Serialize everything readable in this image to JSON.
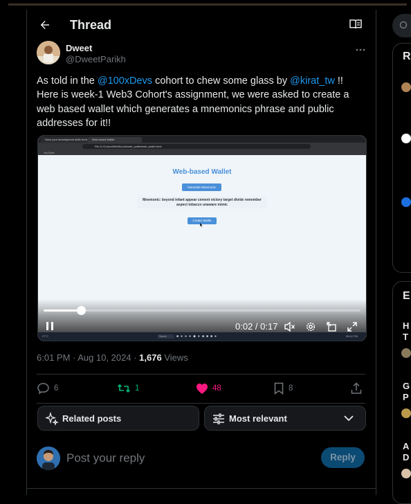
{
  "header": {
    "title": "Thread"
  },
  "author": {
    "name": "Dweet",
    "handle": "@DweetParikh"
  },
  "tweet": {
    "parts": [
      {
        "t": "As told in the ",
        "m": false
      },
      {
        "t": "@100xDevs",
        "m": true
      },
      {
        "t": " cohort to chew some glass by ",
        "m": false
      },
      {
        "t": "@kirat_tw",
        "m": true
      },
      {
        "t": " !! Here is week-1 Web3 Cohort's assignment, we were asked to create a web based wallet which generates a mnemonics phrase and public addresses for it!!",
        "m": false
      }
    ]
  },
  "video": {
    "browser": {
      "tab1": "Save your development skills from...",
      "tab2": "Web based Wallet",
      "url": "File    D:/Cohort/Web3/code/web_wallet/web_wallet.html",
      "bookmark": "YouTube"
    },
    "page": {
      "title": "Web-based Wallet",
      "generate_button": "Generate Mnemonic",
      "mnemonic_text": "Mnemonic: beyond infant appear cement victory target divide remember aspect tobacco unaware mimic",
      "create_button": "Create Wallet"
    },
    "taskbar": {
      "weather": "27°C",
      "search": "Search",
      "clock": "06:42 PM"
    },
    "time_current": "0:02",
    "time_total": "0:17",
    "progress": 0.118
  },
  "meta": {
    "datetime": "6:01 PM · Aug 10, 2024 · ",
    "views_count": "1,676",
    "views_label": " Views"
  },
  "actions": {
    "replies": "6",
    "reposts": "1",
    "likes": "48",
    "bookmarks": "8"
  },
  "filters": {
    "related": "Related posts",
    "relevant": "Most relevant"
  },
  "reply": {
    "placeholder": "Post your reply",
    "button": "Reply"
  },
  "right_panels": {
    "p1": "R",
    "p2": "E",
    "r1": "H",
    "r2": "T",
    "r3": "G",
    "r4": "P",
    "r5": "A",
    "r6": "D"
  },
  "colors": {
    "accent": "#1d9bf0",
    "like": "#f91880",
    "repost": "#00ba7c",
    "background": "#000000"
  }
}
